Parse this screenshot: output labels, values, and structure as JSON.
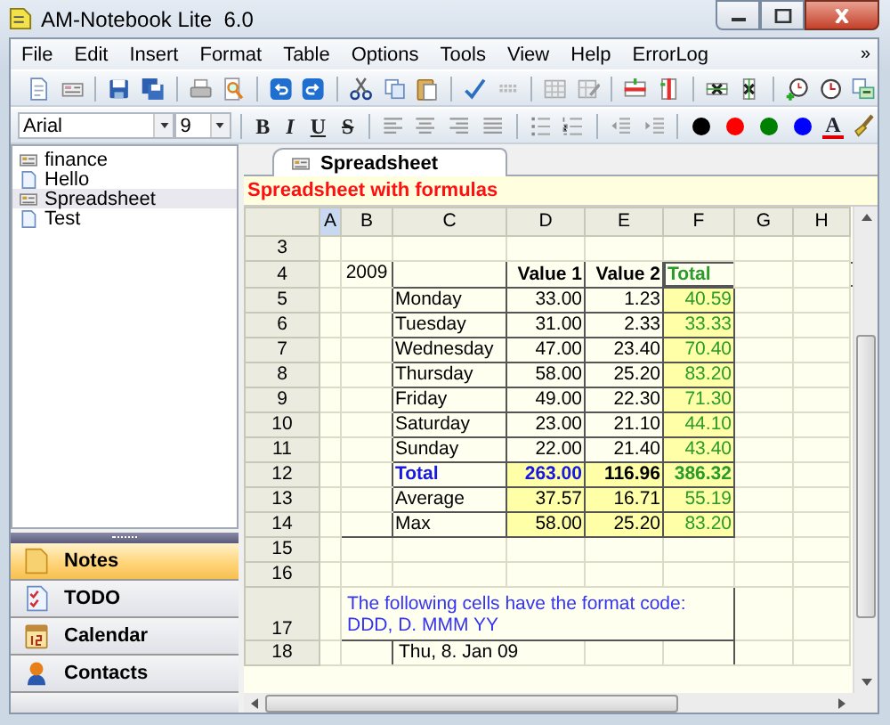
{
  "window": {
    "title": "AM-Notebook Lite  6.0"
  },
  "menu": [
    {
      "label": "File"
    },
    {
      "label": "Edit"
    },
    {
      "label": "Insert"
    },
    {
      "label": "Format"
    },
    {
      "label": "Table"
    },
    {
      "label": "Options"
    },
    {
      "label": "Tools"
    },
    {
      "label": "View"
    },
    {
      "label": "Help"
    },
    {
      "label": "ErrorLog"
    }
  ],
  "menu_overflow": "»",
  "font": {
    "family": "Arial",
    "size": "9"
  },
  "format_buttons": [
    {
      "label": "B",
      "kind": "bold"
    },
    {
      "label": "I",
      "kind": "italic"
    },
    {
      "label": "U",
      "kind": "underline"
    },
    {
      "label": "S",
      "kind": "strike"
    }
  ],
  "color_buttons": [
    {
      "color": "#000000"
    },
    {
      "color": "#ff0000"
    },
    {
      "color": "#008000"
    },
    {
      "color": "#0000ff"
    }
  ],
  "font_color_button": {
    "label": "A"
  },
  "notes": [
    {
      "label": "finance",
      "kind": "sheet",
      "selected": false
    },
    {
      "label": "Hello",
      "kind": "note",
      "selected": false
    },
    {
      "label": "Spreadsheet",
      "kind": "sheet",
      "selected": true
    },
    {
      "label": "Test",
      "kind": "note",
      "selected": false
    }
  ],
  "nav": [
    {
      "label": "Notes",
      "kind": "notes",
      "selected": true
    },
    {
      "label": "TODO",
      "kind": "todo",
      "selected": false
    },
    {
      "label": "Calendar",
      "kind": "calendar",
      "selected": false
    },
    {
      "label": "Contacts",
      "kind": "contacts",
      "selected": false
    }
  ],
  "tabs": [
    {
      "label": "Spreadsheet",
      "selected": true
    }
  ],
  "sheet": {
    "title": "Spreadsheet with formulas",
    "columns": [
      {
        "label": "A",
        "selected": true
      },
      {
        "label": "B",
        "selected": false
      },
      {
        "label": "C",
        "selected": false
      },
      {
        "label": "D",
        "selected": false
      },
      {
        "label": "E",
        "selected": false
      },
      {
        "label": "F",
        "selected": false
      },
      {
        "label": "G",
        "selected": false
      },
      {
        "label": "H",
        "selected": false
      }
    ],
    "rows": [
      {
        "header": "3",
        "kind": "blank"
      },
      {
        "header": "4",
        "kind": "heading",
        "year": "2009",
        "value_1": "Value 1",
        "value_2": "Value 2",
        "total": "Total"
      },
      {
        "header": "5",
        "kind": "day",
        "label": "Monday",
        "value_1": "33.00",
        "value_2": "1.23",
        "total": "40.59"
      },
      {
        "header": "6",
        "kind": "day",
        "label": "Tuesday",
        "value_1": "31.00",
        "value_2": "2.33",
        "total": "33.33"
      },
      {
        "header": "7",
        "kind": "day",
        "label": "Wednesday",
        "value_1": "47.00",
        "value_2": "23.40",
        "total": "70.40"
      },
      {
        "header": "8",
        "kind": "day",
        "label": "Thursday",
        "value_1": "58.00",
        "value_2": "25.20",
        "total": "83.20"
      },
      {
        "header": "9",
        "kind": "day",
        "label": "Friday",
        "value_1": "49.00",
        "value_2": "22.30",
        "total": "71.30"
      },
      {
        "header": "10",
        "kind": "day",
        "label": "Saturday",
        "value_1": "23.00",
        "value_2": "21.10",
        "total": "44.10"
      },
      {
        "header": "11",
        "kind": "day",
        "label": "Sunday",
        "value_1": "22.00",
        "value_2": "21.40",
        "total": "43.40"
      },
      {
        "header": "12",
        "kind": "sum",
        "label": "Total",
        "value_1": "263.00",
        "value_2": "116.96",
        "total": "386.32"
      },
      {
        "header": "13",
        "kind": "stat",
        "label": "Average",
        "value_1": "37.57",
        "value_2": "16.71",
        "total": "55.19"
      },
      {
        "header": "14",
        "kind": "stat",
        "label": "Max",
        "value_1": "58.00",
        "value_2": "25.20",
        "total": "83.20"
      },
      {
        "header": "15",
        "kind": "blank"
      },
      {
        "header": "16",
        "kind": "blank"
      },
      {
        "header": "17",
        "kind": "note",
        "lines": [
          "The following cells have the format code:",
          "DDD, D. MMM YY"
        ]
      },
      {
        "header": "18",
        "kind": "date",
        "label": "Thu, 8. Jan 09"
      }
    ]
  }
}
